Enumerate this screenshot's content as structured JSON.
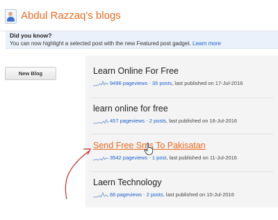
{
  "header": {
    "title": "Abdul Razzaq's blogs",
    "logo_icon": "blogger-profile-icon"
  },
  "notice": {
    "title": "Did you know?",
    "text": "You can now highlight a selected post with the new Featured post gadget.",
    "link": "Learn more"
  },
  "sidebar": {
    "new_blog_label": "New Blog"
  },
  "blogs": [
    {
      "name": "Learn Online For Free",
      "pageviews": "9496 pageviews",
      "posts": "35 posts",
      "published": ", last published on 17-Jul-2016"
    },
    {
      "name": "learn online for free",
      "pageviews": "457 pageviews",
      "posts": "2 posts",
      "published": ", last published on 16-Jul-2016"
    },
    {
      "name": "Send Free Sms To Pakisatan",
      "pageviews": "3542 pageviews",
      "posts": "1 post",
      "published": ", last published on 11-Jul-2016"
    },
    {
      "name": "Laern Technology",
      "pageviews": "66 pageviews",
      "posts": "2 posts",
      "published": ", last published on 10-Jul-2016"
    }
  ],
  "separator": "-",
  "colors": {
    "accent": "#ea6a1f",
    "link": "#1a5fcc",
    "annotation": "#c62828"
  }
}
